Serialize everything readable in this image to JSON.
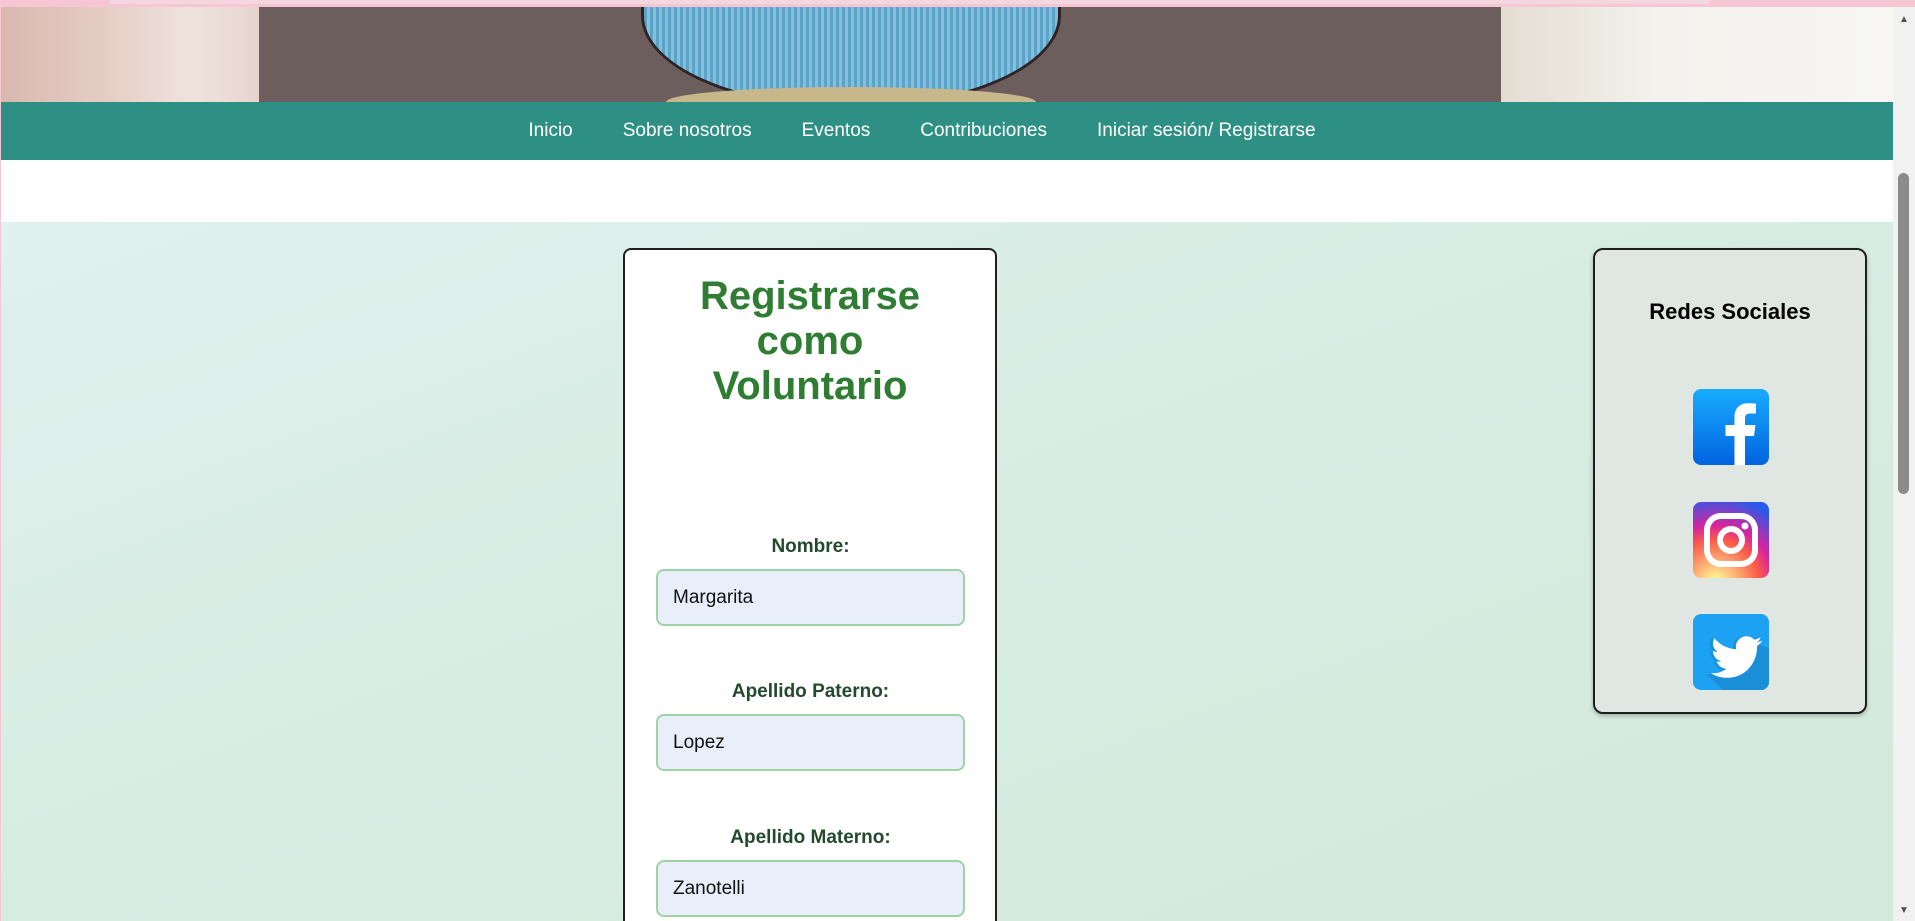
{
  "nav": {
    "items": [
      "Inicio",
      "Sobre nosotros",
      "Eventos",
      "Contribuciones",
      "Iniciar sesión/ Registrarse"
    ]
  },
  "form": {
    "title": "Registrarse como Voluntario",
    "fields": [
      {
        "label": "Nombre:",
        "value": "Margarita"
      },
      {
        "label": "Apellido Paterno:",
        "value": "Lopez"
      },
      {
        "label": "Apellido Materno:",
        "value": "Zanotelli"
      }
    ]
  },
  "social": {
    "title": "Redes Sociales",
    "icons": [
      "facebook-icon",
      "instagram-icon",
      "twitter-icon"
    ]
  },
  "colors": {
    "nav_bg": "#2e8f84",
    "title_green": "#2e7d32",
    "input_bg": "#e8effa",
    "input_border": "#9fd2a4"
  }
}
